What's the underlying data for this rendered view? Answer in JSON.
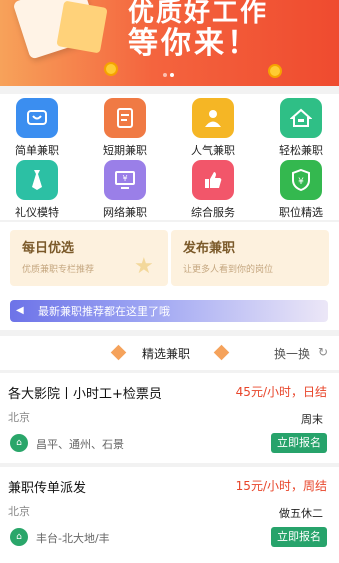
{
  "banner": {
    "line1": "优质好工作",
    "line2": "等你来！",
    "slides": 2,
    "active_slide": 1
  },
  "categories": [
    {
      "label": "简单兼职",
      "icon": "cart-icon",
      "color": "#3b8ef0"
    },
    {
      "label": "短期兼职",
      "icon": "document-icon",
      "color": "#f07a44"
    },
    {
      "label": "人气兼职",
      "icon": "person-icon",
      "color": "#f5b625"
    },
    {
      "label": "轻松兼职",
      "icon": "house-icon",
      "color": "#2fbf86"
    },
    {
      "label": "礼仪模特",
      "icon": "tie-icon",
      "color": "#2cc0a4"
    },
    {
      "label": "网络兼职",
      "icon": "computer-icon",
      "color": "#9a7fe8"
    },
    {
      "label": "综合服务",
      "icon": "thumbs-up-icon",
      "color": "#f2566a"
    },
    {
      "label": "职位精选",
      "icon": "shield-yen-icon",
      "color": "#34b84f"
    }
  ],
  "promo": {
    "daily": {
      "title": "每日优选",
      "subtitle": "优质兼职专栏推荐"
    },
    "publish": {
      "title": "发布兼职",
      "subtitle": "让更多人看到你的岗位"
    }
  },
  "notice": {
    "text": "最新兼职推荐都在这里了哦"
  },
  "section": {
    "title": "精选兼职",
    "refresh_label": "换一换"
  },
  "jobs": [
    {
      "name": "各大影院丨小时工+检票员",
      "pay": "45元/小时，日结",
      "city": "北京",
      "schedule": "周末",
      "area": "昌平、通州、石景",
      "apply_label": "立即报名"
    },
    {
      "name": "兼职传单派发",
      "pay": "15元/小时，周结",
      "city": "北京",
      "schedule": "做五休二",
      "area": "丰台-北大地/丰",
      "apply_label": "立即报名"
    }
  ],
  "colors": {
    "accent": "#27a36b",
    "pay": "#e8452a",
    "banner": "#f4643e"
  }
}
